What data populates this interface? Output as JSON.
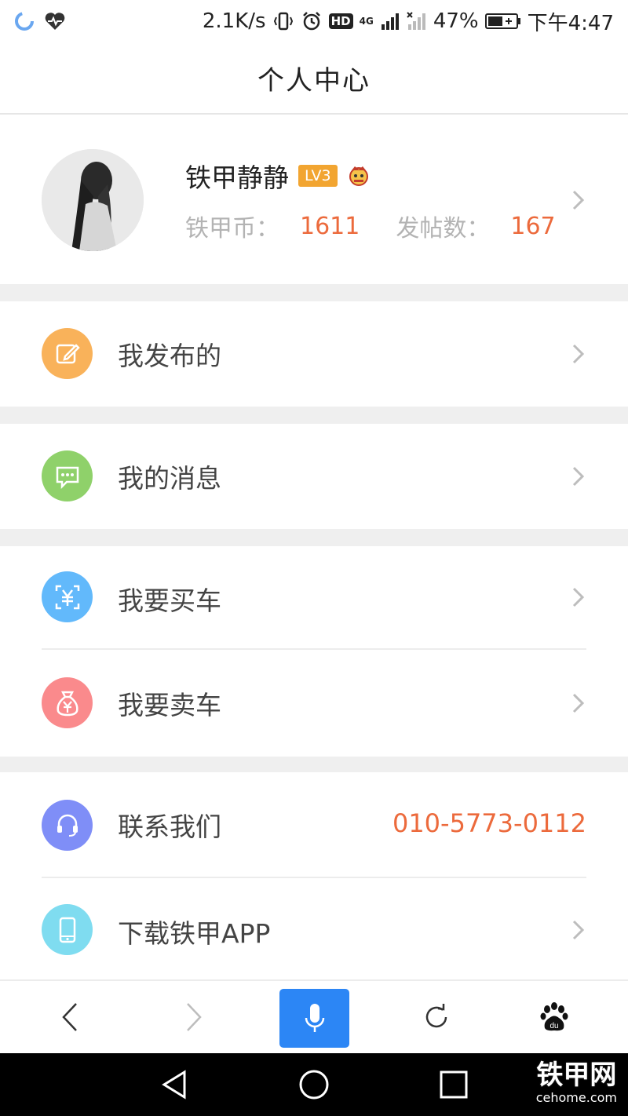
{
  "status_bar": {
    "speed": "2.1K/s",
    "hd": "HD",
    "network": "4G",
    "battery": "47%",
    "time": "下午4:47"
  },
  "header": {
    "title": "个人中心"
  },
  "profile": {
    "name": "铁甲静静",
    "level": "LV3",
    "coins_label": "铁甲币：",
    "coins": "1611",
    "posts_label": "发帖数：",
    "posts": "167"
  },
  "menu": {
    "published": "我发布的",
    "messages": "我的消息",
    "buy_car": "我要买车",
    "sell_car": "我要卖车",
    "contact": "联系我们",
    "contact_phone": "010-5773-0112",
    "download": "下载铁甲APP"
  },
  "colors": {
    "accent": "#ec6a3c",
    "published_icon": "#f9b25a",
    "messages_icon": "#8fd16a",
    "buy_icon": "#62b9fb",
    "sell_icon": "#fa8a8c",
    "contact_icon": "#7f8ef7",
    "download_icon": "#7fdcf0",
    "mic_button": "#2c86f5",
    "level_badge": "#f2a531"
  },
  "watermark": {
    "main": "铁甲网",
    "sub": "cehome.com"
  }
}
